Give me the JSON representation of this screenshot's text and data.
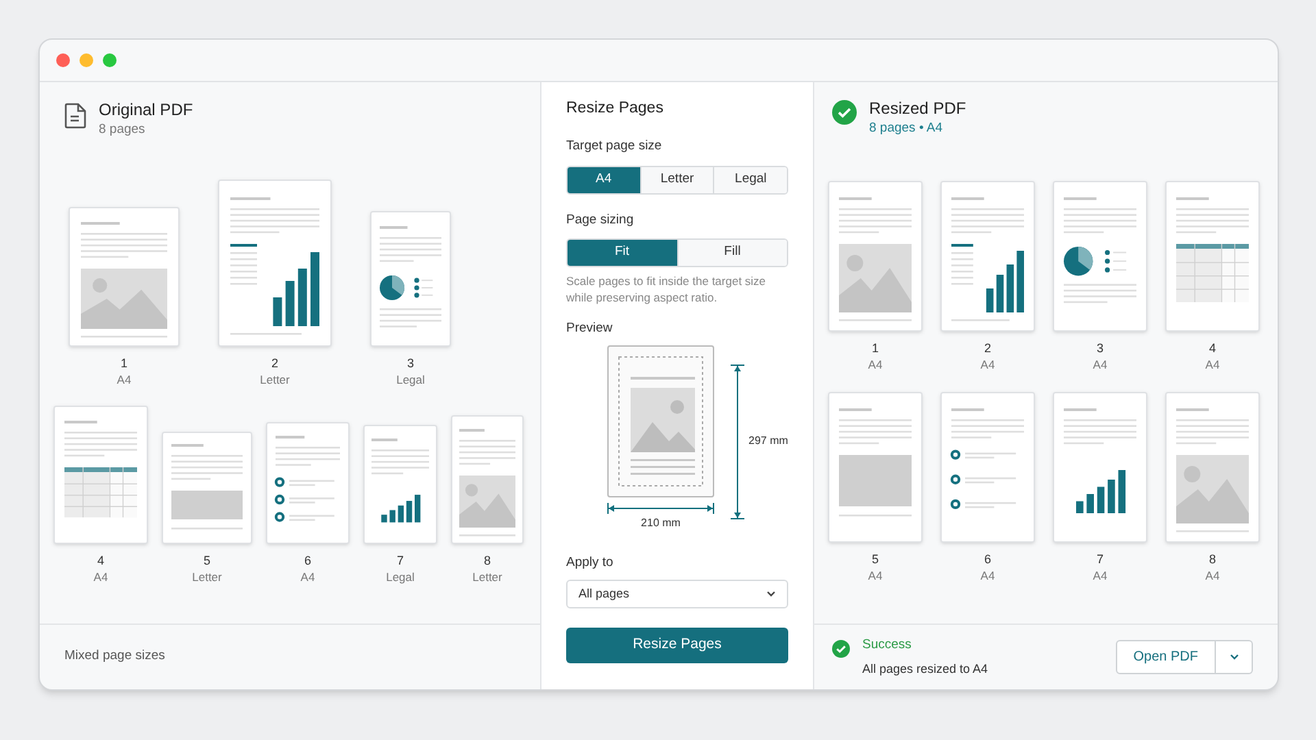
{
  "original": {
    "title": "Original PDF",
    "subtitle": "8 pages",
    "pages": [
      {
        "number": "1",
        "size": "A4",
        "kind": "image"
      },
      {
        "number": "2",
        "size": "Letter",
        "kind": "bars"
      },
      {
        "number": "3",
        "size": "Legal",
        "kind": "pie"
      },
      {
        "number": "4",
        "size": "A4",
        "kind": "table"
      },
      {
        "number": "5",
        "size": "Letter",
        "kind": "block"
      },
      {
        "number": "6",
        "size": "A4",
        "kind": "bullets"
      },
      {
        "number": "7",
        "size": "Legal",
        "kind": "steps"
      },
      {
        "number": "8",
        "size": "Letter",
        "kind": "image"
      }
    ],
    "footer": "Mixed page sizes"
  },
  "settings": {
    "title": "Resize Pages",
    "target_label": "Target page size",
    "target_options": [
      {
        "label": "A4",
        "selected": true
      },
      {
        "label": "Letter",
        "selected": false
      },
      {
        "label": "Legal",
        "selected": false
      }
    ],
    "sizing_label": "Page sizing",
    "sizing_options": [
      {
        "label": "Fit",
        "selected": true
      },
      {
        "label": "Fill",
        "selected": false
      }
    ],
    "sizing_hint": "Scale pages to fit inside the target size while preserving aspect ratio.",
    "preview_label": "Preview",
    "preview_height": "297 mm",
    "preview_width": "210 mm",
    "apply_label": "Apply to",
    "apply_value": "All pages",
    "button": "Resize Pages"
  },
  "resized": {
    "title": "Resized PDF",
    "subtitle": "8 pages • A4",
    "pages": [
      {
        "number": "1",
        "size": "A4",
        "kind": "image"
      },
      {
        "number": "2",
        "size": "A4",
        "kind": "bars"
      },
      {
        "number": "3",
        "size": "A4",
        "kind": "pie"
      },
      {
        "number": "4",
        "size": "A4",
        "kind": "table"
      },
      {
        "number": "5",
        "size": "A4",
        "kind": "block"
      },
      {
        "number": "6",
        "size": "A4",
        "kind": "bullets"
      },
      {
        "number": "7",
        "size": "A4",
        "kind": "steps"
      },
      {
        "number": "8",
        "size": "A4",
        "kind": "image"
      }
    ],
    "status_title": "Success",
    "status_text": "All pages resized to A4",
    "open_button": "Open PDF"
  }
}
